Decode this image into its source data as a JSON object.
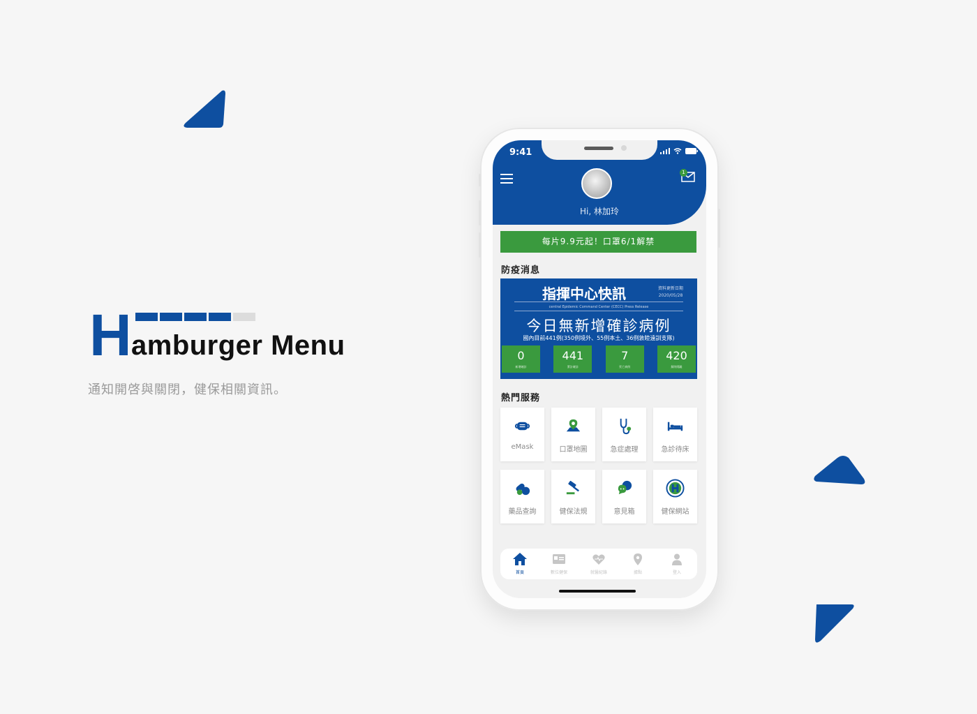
{
  "title": {
    "initial": "H",
    "rest": "amburger Menu",
    "subtitle": "通知開啓與關閉，健保相關資訊。"
  },
  "colors": {
    "brand": "#0e4fa0",
    "accent_green": "#3a9a3e"
  },
  "phone": {
    "status_time": "9:41",
    "greeting": "Hi,  林加玲",
    "mail_badge": "1",
    "promo": "每片9.9元起！口罩6/1解禁",
    "section_news": "防疫消息",
    "news": {
      "title": "指揮中心快訊",
      "date_label": "資料更新日期",
      "date": "2020/05/28",
      "en": "central Epidemic Command Center (CECC) Press Release",
      "headline": "今日無新增確診病例",
      "sub": "國內目前441例(350例境外、55例本土、36例敦睦遠訓支隊)",
      "stats": [
        {
          "value": "0",
          "label": "新增確診"
        },
        {
          "value": "441",
          "label": "累計確診"
        },
        {
          "value": "7",
          "label": "死亡病例"
        },
        {
          "value": "420",
          "label": "解除隔離"
        }
      ]
    },
    "section_services": "熱門服務",
    "services": [
      {
        "label": "eMask",
        "icon": "mask-icon"
      },
      {
        "label": "口罩地圖",
        "icon": "map-pin-icon"
      },
      {
        "label": "急症處理",
        "icon": "stethoscope-icon"
      },
      {
        "label": "急診待床",
        "icon": "bed-icon"
      },
      {
        "label": "藥品查詢",
        "icon": "pills-icon"
      },
      {
        "label": "健保法規",
        "icon": "gavel-icon"
      },
      {
        "label": "意見箱",
        "icon": "chat-icon"
      },
      {
        "label": "健保網站",
        "icon": "nhi-logo-icon"
      }
    ],
    "tabs": [
      {
        "label": "首頁",
        "icon": "home-icon"
      },
      {
        "label": "數位健保",
        "icon": "id-card-icon"
      },
      {
        "label": "就醫紀錄",
        "icon": "heart-icon"
      },
      {
        "label": "據點",
        "icon": "location-icon"
      },
      {
        "label": "登入",
        "icon": "user-icon"
      }
    ]
  }
}
